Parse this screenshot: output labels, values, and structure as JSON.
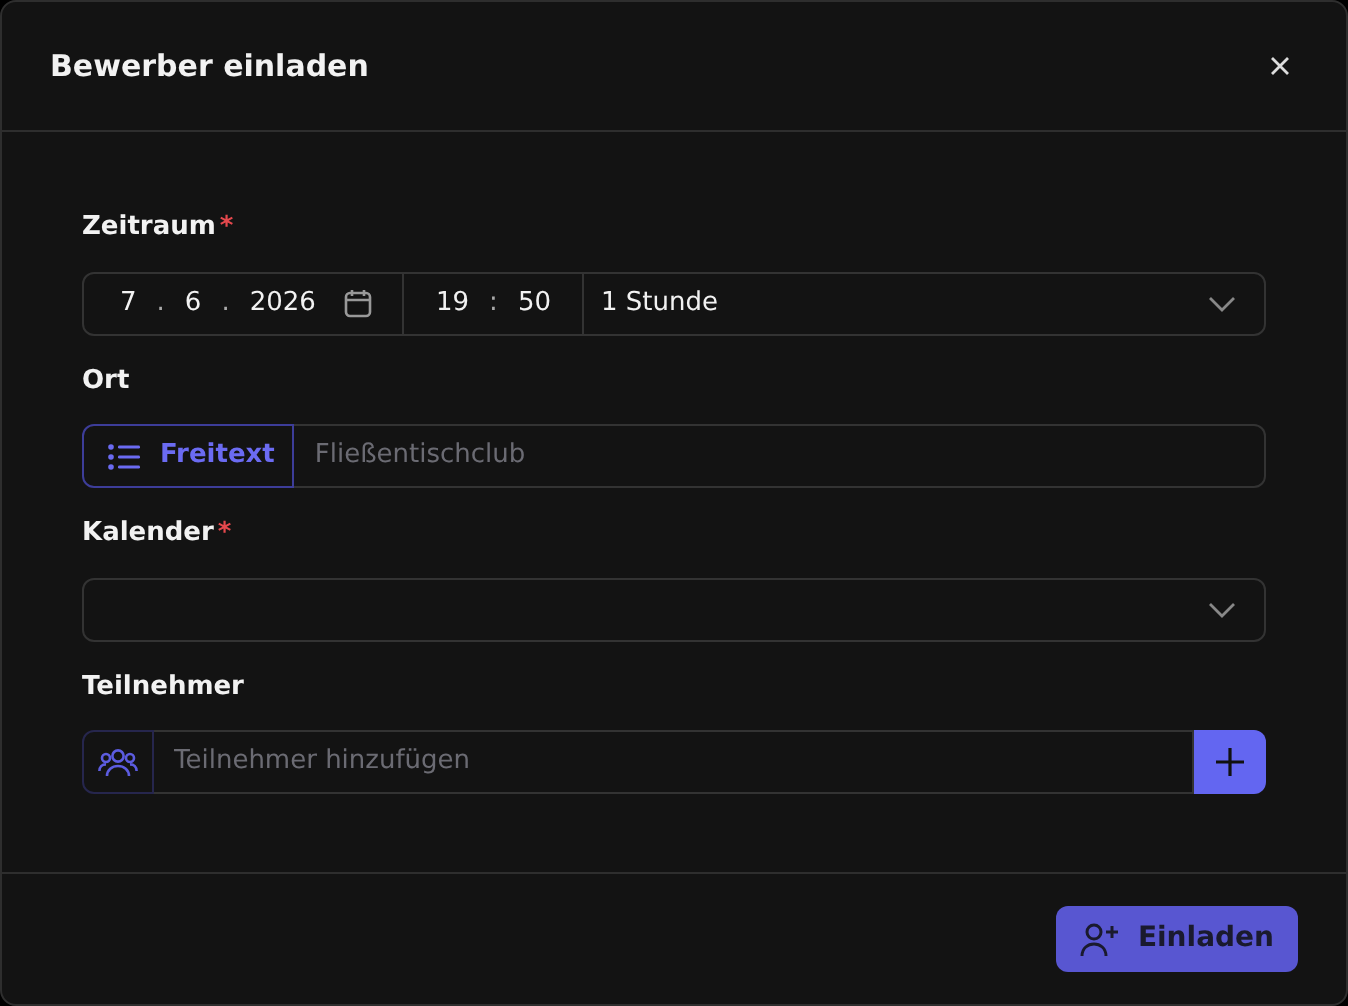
{
  "dialog": {
    "title": "Bewerber einladen"
  },
  "zeitraum": {
    "label": "Zeitraum",
    "required_mark": "*",
    "date": {
      "day": "7",
      "month": "6",
      "year": "2026",
      "separator": "."
    },
    "time": {
      "hour": "19",
      "minute": "50",
      "separator": ":"
    },
    "duration": "1 Stunde"
  },
  "ort": {
    "label": "Ort",
    "mode": "Freitext",
    "placeholder": "Fließentischclub"
  },
  "kalender": {
    "label": "Kalender",
    "required_mark": "*"
  },
  "teilnehmer": {
    "label": "Teilnehmer",
    "placeholder": "Teilnehmer hinzufügen"
  },
  "footer": {
    "submit": "Einladen"
  }
}
